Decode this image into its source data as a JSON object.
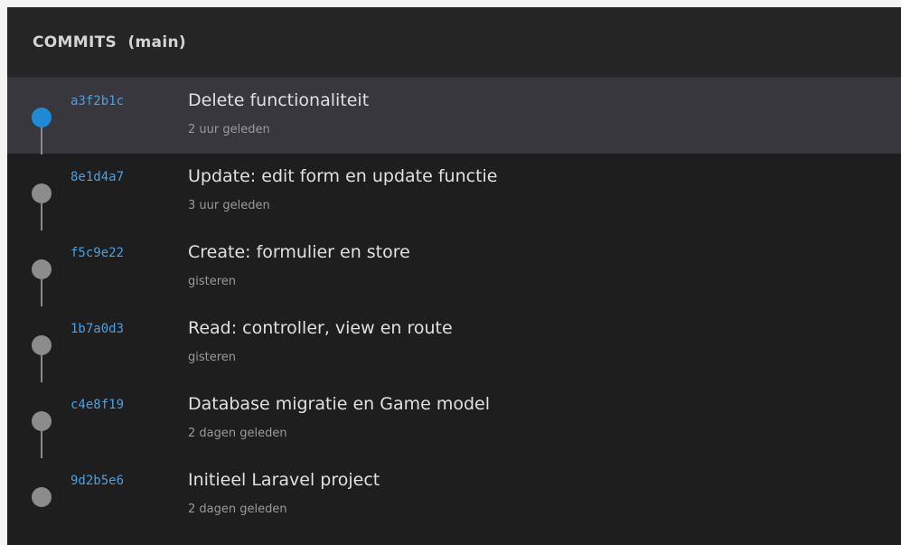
{
  "header": {
    "title": "COMMITS  (main)"
  },
  "colors": {
    "panel_bg": "#1e1e1e",
    "header_bg": "#252526",
    "selected_row_bg": "#37373d",
    "hash_color": "#4d9fe0",
    "active_dot": "#1f8ad6",
    "inactive_dot": "#8c8c8c"
  },
  "commits": [
    {
      "hash": "a3f2b1c",
      "message": "Delete functionaliteit",
      "time": "2 uur geleden",
      "selected": true
    },
    {
      "hash": "8e1d4a7",
      "message": "Update: edit form en update functie",
      "time": "3 uur geleden",
      "selected": false
    },
    {
      "hash": "f5c9e22",
      "message": "Create: formulier en store",
      "time": "gisteren",
      "selected": false
    },
    {
      "hash": "1b7a0d3",
      "message": "Read: controller, view en route",
      "time": "gisteren",
      "selected": false
    },
    {
      "hash": "c4e8f19",
      "message": "Database migratie en Game model",
      "time": "2 dagen geleden",
      "selected": false
    },
    {
      "hash": "9d2b5e6",
      "message": "Initieel Laravel project",
      "time": "2 dagen geleden",
      "selected": false
    }
  ]
}
